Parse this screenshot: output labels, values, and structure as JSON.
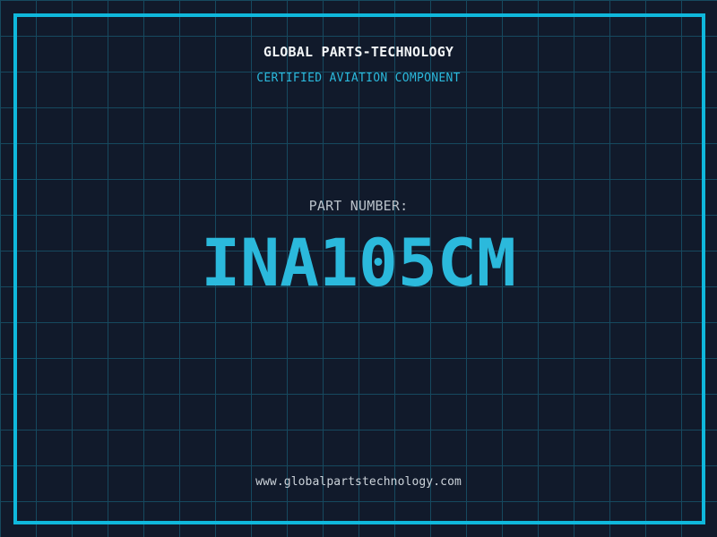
{
  "header": {
    "title": "GLOBAL PARTS-TECHNOLOGY",
    "subtitle": "CERTIFIED AVIATION COMPONENT"
  },
  "part": {
    "label": "PART NUMBER:",
    "number": "INA105CM"
  },
  "footer": {
    "url": "www.globalpartstechnology.com"
  },
  "colors": {
    "background": "#111a2b",
    "grid_line": "#16495f",
    "frame": "#0fb8dc",
    "accent_cyan": "#2bb9dc",
    "title_white": "#f2f5f7",
    "label_gray": "#b9c1c9",
    "url_gray": "#ccd3da"
  }
}
